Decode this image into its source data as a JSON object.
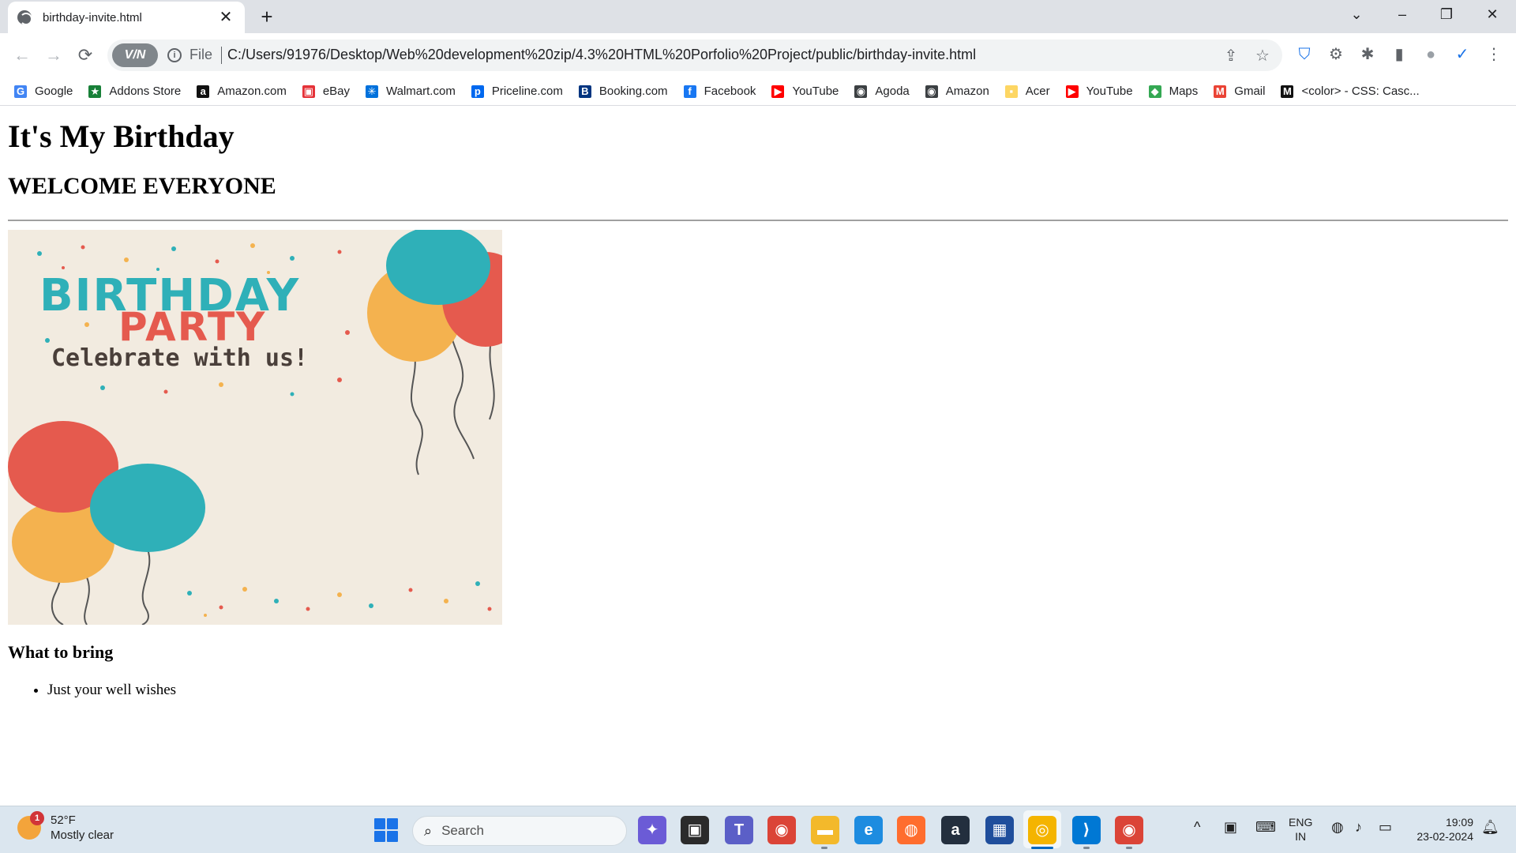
{
  "browser": {
    "tab": {
      "title": "birthday-invite.html",
      "close": "✕"
    },
    "new_tab": "+",
    "window_controls": {
      "tab_search": "⌄",
      "minimize": "–",
      "restore": "❐",
      "close": "✕"
    },
    "nav": {
      "back": "←",
      "forward": "→",
      "reload": "⟳"
    },
    "omnibox": {
      "vpn": "V/N",
      "info": "i",
      "scheme_label": "File",
      "url": "C:/Users/91976/Desktop/Web%20development%20zip/4.3%20HTML%20Porfolio%20Project/public/birthday-invite.html",
      "share_icon": "⇪",
      "star_icon": "☆"
    },
    "extensions": {
      "shield": "⛉",
      "gear": "⚙",
      "puzzle": "✱",
      "sidepanel": "▮",
      "profile": "●",
      "check": "✓",
      "menu": "⋮"
    },
    "bookmarks": [
      {
        "label": "Google",
        "icon": "G",
        "color": "#4285f4"
      },
      {
        "label": "Addons Store",
        "icon": "★",
        "color": "#188038"
      },
      {
        "label": "Amazon.com",
        "icon": "a",
        "color": "#111111"
      },
      {
        "label": "eBay",
        "icon": "▣",
        "color": "#e53238"
      },
      {
        "label": "Walmart.com",
        "icon": "✳",
        "color": "#0071dc"
      },
      {
        "label": "Priceline.com",
        "icon": "p",
        "color": "#0068ef"
      },
      {
        "label": "Booking.com",
        "icon": "B",
        "color": "#003580"
      },
      {
        "label": "Facebook",
        "icon": "f",
        "color": "#1877f2"
      },
      {
        "label": "YouTube",
        "icon": "▶",
        "color": "#ff0000"
      },
      {
        "label": "Agoda",
        "icon": "◉",
        "color": "#3c4043"
      },
      {
        "label": "Amazon",
        "icon": "◉",
        "color": "#3c4043"
      },
      {
        "label": "Acer",
        "icon": "▪",
        "color": "#fdd663"
      },
      {
        "label": "YouTube",
        "icon": "▶",
        "color": "#ff0000"
      },
      {
        "label": "Maps",
        "icon": "◆",
        "color": "#34a853"
      },
      {
        "label": "Gmail",
        "icon": "M",
        "color": "#ea4335"
      },
      {
        "label": "<color> - CSS: Casc...",
        "icon": "M",
        "color": "#111111"
      }
    ]
  },
  "page": {
    "h1": "It's My Birthday",
    "h2": "WELCOME EVERYONE",
    "image": {
      "line1": "BIRTHDAY",
      "line2": "PARTY",
      "line3": "Celebrate with us!",
      "colors": {
        "background": "#f2ebe0",
        "teal": "#2fb0b8",
        "red": "#e55a4e",
        "orange": "#f4b24f",
        "text": "#4a3f3a"
      }
    },
    "h3": "What to bring",
    "list": [
      "Just your well wishes"
    ]
  },
  "taskbar": {
    "weather": {
      "temp": "52°F",
      "condition": "Mostly clear",
      "badge": "1"
    },
    "search_placeholder": "Search",
    "apps": [
      {
        "name": "copilot",
        "glyph": "✦",
        "color": "#6b5bd6"
      },
      {
        "name": "task-view",
        "glyph": "▣",
        "color": "#2b2b2b"
      },
      {
        "name": "teams",
        "glyph": "T",
        "color": "#5b5fc7"
      },
      {
        "name": "chrome",
        "glyph": "◉",
        "color": "#db4437"
      },
      {
        "name": "file-explorer",
        "glyph": "▬",
        "color": "#f3b92b"
      },
      {
        "name": "edge",
        "glyph": "e",
        "color": "#1d8ce0"
      },
      {
        "name": "firefox",
        "glyph": "◍",
        "color": "#ff6d2e"
      },
      {
        "name": "amazon",
        "glyph": "a",
        "color": "#232f3e"
      },
      {
        "name": "store",
        "glyph": "▦",
        "color": "#1f4e9c"
      },
      {
        "name": "browser",
        "glyph": "◎",
        "color": "#f4b400"
      },
      {
        "name": "vscode",
        "glyph": "⟩",
        "color": "#0078d4"
      },
      {
        "name": "chrome-profile",
        "glyph": "◉",
        "color": "#db4437"
      }
    ],
    "tray": {
      "chevron": "^",
      "lang_top": "ENG",
      "lang_bottom": "IN",
      "time": "19:09",
      "date": "23-02-2024"
    }
  }
}
